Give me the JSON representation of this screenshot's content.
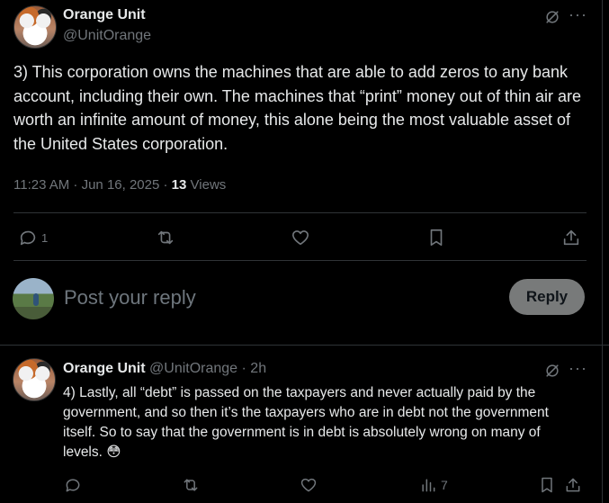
{
  "main_post": {
    "author_name": "Orange Unit",
    "author_handle": "@UnitOrange",
    "text": "3) This corporation owns the machines that are able to add zeros to any bank account, including their own. The machines that “print” money out of thin air are worth an infinite amount of money, this alone being the most valuable asset of the United States corporation.",
    "timestamp": "11:23 AM · Jun 16, 2025 ·",
    "views_count": "13",
    "views_label": "Views",
    "reply_count": "1"
  },
  "composer": {
    "placeholder": "Post your reply",
    "button_label": "Reply"
  },
  "reply_post": {
    "author_name": "Orange Unit",
    "author_handle": "@UnitOrange",
    "age": "· 2h",
    "text": "4) Lastly, all “debt” is passed on the taxpayers and never actually paid by the government, and so then it’s the taxpayers who are in debt not the government itself. So to say that the government is in debt is absolutely wrong on many of levels. 😳",
    "views_count": "7"
  },
  "more_glyph": "···",
  "colors": {
    "background": "#000000",
    "text": "#e7e9ea",
    "muted": "#71767b",
    "divider": "#2f3336",
    "reply_button_bg": "#787a7a"
  }
}
